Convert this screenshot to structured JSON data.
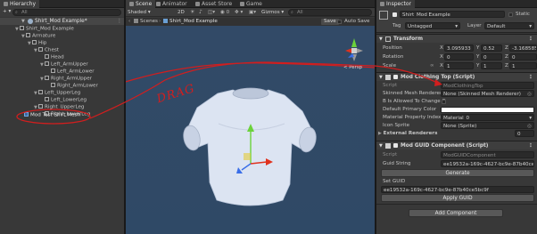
{
  "hierarchy": {
    "tab": "Hierarchy",
    "add": "+ ▾",
    "search_placeholder": "All",
    "scene_name": "Shirt_Mod Example*",
    "items": [
      {
        "label": "Shirt_Mod Example"
      },
      {
        "label": "Armature"
      },
      {
        "label": "Hip"
      },
      {
        "label": "Chest"
      },
      {
        "label": "Head"
      },
      {
        "label": "Left_ArmUpper"
      },
      {
        "label": "Left_ArmLower"
      },
      {
        "label": "Right_ArmUpper"
      },
      {
        "label": "Right_ArmLower"
      },
      {
        "label": "Left_UpperLeg"
      },
      {
        "label": "Left_LowerLeg"
      },
      {
        "label": "Right_UpperLeg"
      },
      {
        "label": "Right_LowerLeg"
      },
      {
        "label": "Mod Test Shirt Mesh"
      }
    ]
  },
  "scene": {
    "tabs": {
      "scene": "Scene",
      "animator": "Animator",
      "asset_store": "Asset Store",
      "game": "Game"
    },
    "toolbar": {
      "shading": "Shaded",
      "mode_2d": "2D",
      "gizmos": "Gizmos",
      "search": "All"
    },
    "breadcrumb": {
      "scenes": "Scenes",
      "title": "Shirt_Mod Example",
      "save": "Save",
      "auto_save": "Auto Save"
    },
    "persp": "< Persp",
    "annotation": "DRAG"
  },
  "inspector": {
    "tab": "Inspector",
    "object_name": "Shirt_Mod Example",
    "static_label": "Static",
    "tag_label": "Tag",
    "tag_value": "Untagged",
    "layer_label": "Layer",
    "layer_value": "Default",
    "transform": {
      "title": "Transform",
      "position_label": "Position",
      "rotation_label": "Rotation",
      "scale_label": "Scale",
      "position": [
        "3.095933",
        "0.52",
        "-3.168585"
      ],
      "rotation": [
        "0",
        "0",
        "0"
      ],
      "scale": [
        "1",
        "1",
        "1"
      ]
    },
    "mod_clothing": {
      "title": "Mod Clothing Top (Script)",
      "script_label": "Script",
      "script_value": "ModClothingTop",
      "skinned_label": "Skinned Mesh Renderer",
      "skinned_value": "None (Skinned Mesh Renderer)",
      "allowed_label": "B Is Allowed To Change C",
      "primary_color_label": "Default Primary Color",
      "material_label": "Material Property Index",
      "material_value": "Material_0",
      "sprite_label": "Icon Sprite",
      "sprite_value": "None (Sprite)",
      "external_label": "External Renderers",
      "external_value": "0"
    },
    "mod_guid": {
      "title": "Mod GUID Component (Script)",
      "script_label": "Script",
      "script_value": "ModGUIDComponent",
      "guid_label": "Guid String",
      "guid_value": "ee19532a-169c-4627-bc9e-87b40ce5bc9f",
      "generate": "Generate",
      "set_guid_label": "Set GUID",
      "set_guid_value": "ee19532a-169c-4627-bc9e-87b40ce5bc9f",
      "apply": "Apply GUID"
    },
    "add_component": "Add Component"
  },
  "colors": {
    "panel": "#383838",
    "scene_bg": "#2f4b6b",
    "selection": "#2c5d87",
    "annotation_red": "#d21e1e"
  }
}
